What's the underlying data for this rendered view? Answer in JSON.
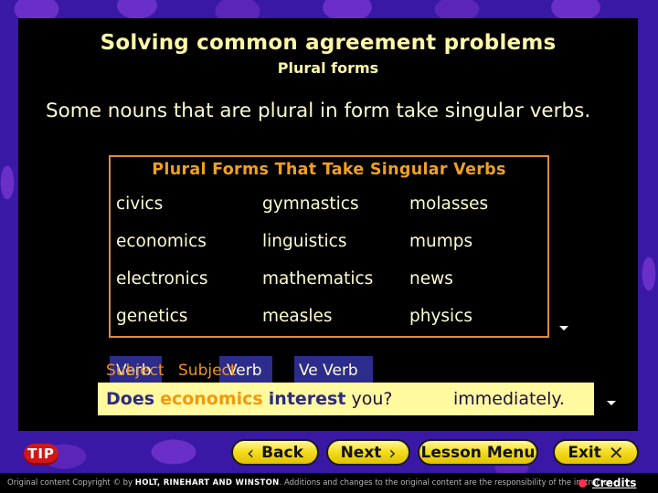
{
  "slide": {
    "title": "Solving common agreement problems",
    "subtitle": "Plural forms",
    "intro": "Some nouns that are plural in form take singular verbs."
  },
  "table": {
    "title": "Plural Forms That Take Singular Verbs",
    "columns": [
      [
        "civics",
        "economics",
        "electronics",
        "genetics"
      ],
      [
        "gymnastics",
        "linguistics",
        "mathematics",
        "measles"
      ],
      [
        "molasses",
        "mumps",
        "news",
        "physics"
      ]
    ]
  },
  "labels": {
    "box1_a": "Subject",
    "box1_b": "Verb",
    "box2_a": "Subject",
    "box2_b": "Verb",
    "box3": "Ve Verb"
  },
  "sentence": {
    "w1": "Does",
    "w2": "economics",
    "w3": "interest",
    "w4": "you?",
    "end": "immediately."
  },
  "nav": {
    "tip": "TIP",
    "back": "Back",
    "next": "Next",
    "lesson_menu": "Lesson Menu",
    "exit": "Exit"
  },
  "footer": {
    "copy_prefix": "Original content Copyright © by",
    "publisher": "HOLT, RINEHART AND WINSTON",
    "copy_suffix": ". Additions and changes to the original content are the responsibility of the instructor.",
    "credits": "Credits"
  },
  "colors": {
    "title_yellow": "#fff7a8",
    "table_orange": "#f0a020",
    "label_blue": "#2c2c8c",
    "button_yellow": "#f5de20"
  }
}
